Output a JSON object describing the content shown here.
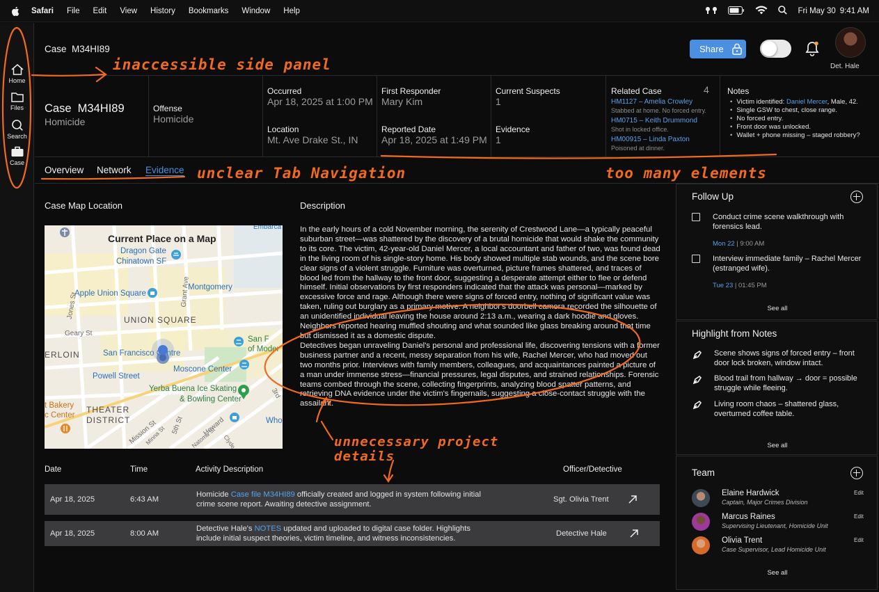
{
  "menubar": {
    "app": "Safari",
    "items": [
      "File",
      "Edit",
      "View",
      "History",
      "Bookmarks",
      "Window",
      "Help"
    ],
    "date": "Fri May 30",
    "time": "9:41 AM"
  },
  "rail": [
    {
      "label": "Home",
      "icon": "home-icon"
    },
    {
      "label": "Files",
      "icon": "folder-icon"
    },
    {
      "label": "Search",
      "icon": "search-icon"
    },
    {
      "label": "Case",
      "icon": "briefcase-icon"
    }
  ],
  "header": {
    "title": "Case  M34HI89",
    "share_label": "Share",
    "user_name": "Det. Hale"
  },
  "info": {
    "case_id": "Case  M34HI89",
    "case_type": "Homicide",
    "offense_label": "Offense",
    "offense_value": "Homicide",
    "occurred_label": "Occurred",
    "occurred_value": "Apr 18, 2025 at 1:00 PM",
    "location_label": "Location",
    "location_value": "Mt. Ave Drake St., IN",
    "first_responder_label": "First Responder",
    "first_responder_value": "Mary Kim",
    "reported_label": "Reported Date",
    "reported_value": "Apr 18, 2025 at 1:49 PM",
    "suspects_label": "Current Suspects",
    "suspects_value": "1",
    "evidence_label": "Evidence",
    "evidence_value": "1",
    "related_label": "Related Case",
    "related_count": "4",
    "related": [
      {
        "link": "HM1127 – Amelia Crowley",
        "desc": "Stabbed at home. No forced entry."
      },
      {
        "link": "HM0715 – Keith Drummond",
        "desc": "Shot in locked office."
      },
      {
        "link": "HM00915 – Linda Paxton",
        "desc": "Poisoned at dinner."
      }
    ],
    "notes_label": "Notes",
    "notes": {
      "victim_prefix": "Victim identified: ",
      "victim_name": "Daniel Mercer",
      "victim_suffix": ", Male, 42.",
      "items": [
        "Single GSW to chest, close range.",
        "No forced entry.",
        "Front door was unlocked.",
        "Wallet + phone missing – staged robbery?"
      ]
    }
  },
  "tabs": [
    "Overview",
    "Network",
    "Evidence"
  ],
  "main": {
    "map_section_title": "Case Map Location",
    "map_title": "Current Place on a Map",
    "map_labels": {
      "dragon_gate": "Dragon Gate",
      "chinatown": "Chinatown SF",
      "embarca": "Embarca",
      "montgomery": "Montgomery",
      "apple_union": "Apple Union Square",
      "union_square": "UNION SQUARE",
      "geary": "Geary St",
      "sfmoma_1": "San F",
      "sfmoma_2": "of Moder",
      "sf_centre": "San Francisco Centre",
      "erlion": "ERLOIN",
      "moscone": "Moscone Center",
      "powell": "Powell Street",
      "yerba_1": "Yerba Buena Ice Skating",
      "yerba_2": "& Bowling Center",
      "bakery_1": "t Bakery",
      "bakery_2": "c Center",
      "theater_1": "THEATER",
      "theater_2": "DISTRICT",
      "who": "Who",
      "jones": "Jones St",
      "grant": "Grant Ave",
      "third": "3rd",
      "mission": "Mission St",
      "fifth": "5th St",
      "minna": "Minna St",
      "howard": "Howard",
      "natoma": "Natoma St",
      "clyde": "Clyde"
    },
    "description_title": "Description",
    "description_p1": "In the early hours of a cold November morning, the serenity of Crestwood Lane—a typically peaceful suburban street—was shattered by the discovery of a brutal homicide that would shake the community to its core. The victim, 42-year-old Daniel Mercer, a local accountant and father of two, was found dead in the living room of his single-story home. His body showed multiple stab wounds, and the scene bore clear signs of a violent struggle. Furniture was overturned, picture frames shattered, and traces of blood led from the hallway to the front door, suggesting a desperate attempt either to flee or defend himself. Initial observations by first responders indicated that the attack was personal—marked by excessive force and rage. Although there were signs of forced entry, nothing of significant value was taken, ruling out burglary as a primary motive. A neighbor's doorbell camera recorded the silhouette of an unidentified individual leaving the house around 2:13 a.m., wearing a dark hoodie and gloves. Neighbors reported hearing muffled shouting and what sounded like glass breaking around that time but dismissed it as a domestic dispute.",
    "description_p2": "Detectives began unraveling Daniel's personal and professional life, discovering tensions with a former business partner and a recent, messy separation from his wife, Rachel Mercer, who had moved out two months prior. Interviews with family members, colleagues, and acquaintances painted a picture of a man under immense stress—financial pressures, legal disputes, and strained relationships. Forensic teams combed through the scene, collecting fingerprints, analyzing blood spatter patterns, and retrieving DNA evidence under the victim's fingernails, suggesting a close-contact struggle with the assailant."
  },
  "activity": {
    "headers": {
      "date": "Date",
      "time": "Time",
      "desc": "Activity Description",
      "officer": "Officer/Detective"
    },
    "rows": [
      {
        "date": "Apr 18, 2025",
        "time": "6:43 AM",
        "pre": "Homicide ",
        "link": "Case file M34HI89",
        "post": " officially created and logged in system following initial crime scene report. Awaiting detective assignment.",
        "officer": "Sgt. Olivia Trent"
      },
      {
        "date": "Apr 18, 2025",
        "time": "8:00 AM",
        "pre": "Detective Hale's ",
        "link": "NOTES",
        "post": " updated and uploaded to digital case folder. Highlights include initial suspect theories, victim timeline, and witness inconsistencies.",
        "officer": "Detective Hale"
      }
    ]
  },
  "follow_up": {
    "title": "Follow Up",
    "items": [
      {
        "text": "Conduct crime scene walkthrough with forensics lead.",
        "day": "Mon 22",
        "time": " | 9:00 AM"
      },
      {
        "text": "Interview immediate family – Rachel Mercer (estranged wife).",
        "day": "Tue 23",
        "time": " | 01:45 PM"
      }
    ],
    "see_all": "See all"
  },
  "highlights": {
    "title": "Highlight from Notes",
    "items": [
      "Scene shows signs of forced entry – front door lock broken, window intact.",
      "Blood trail from hallway → door = possible struggle while fleeing.",
      "Living room chaos – shattered glass, overturned coffee table."
    ],
    "see_all": "See all"
  },
  "team": {
    "title": "Team",
    "members": [
      {
        "name": "Elaine Hardwick",
        "role": "Captain, Major Crimes Division",
        "edit": "Edit"
      },
      {
        "name": "Marcus Raines",
        "role": "Supervising Lieutenant, Homicide Unit",
        "edit": "Edit"
      },
      {
        "name": "Olivia Trent",
        "role": "Case Supervisor, Lead Homicide Unit",
        "edit": "Edit"
      }
    ],
    "see_all": "See all"
  },
  "annotations": {
    "side_panel": "inaccessible side panel",
    "tabs": "unclear Tab Navigation",
    "elements": "too many elements",
    "details_1": "unnecessary project",
    "details_2": "details"
  },
  "colors": {
    "accent": "#4a8fe0",
    "link": "#5aa0e6",
    "annotation": "#f06a1f"
  }
}
